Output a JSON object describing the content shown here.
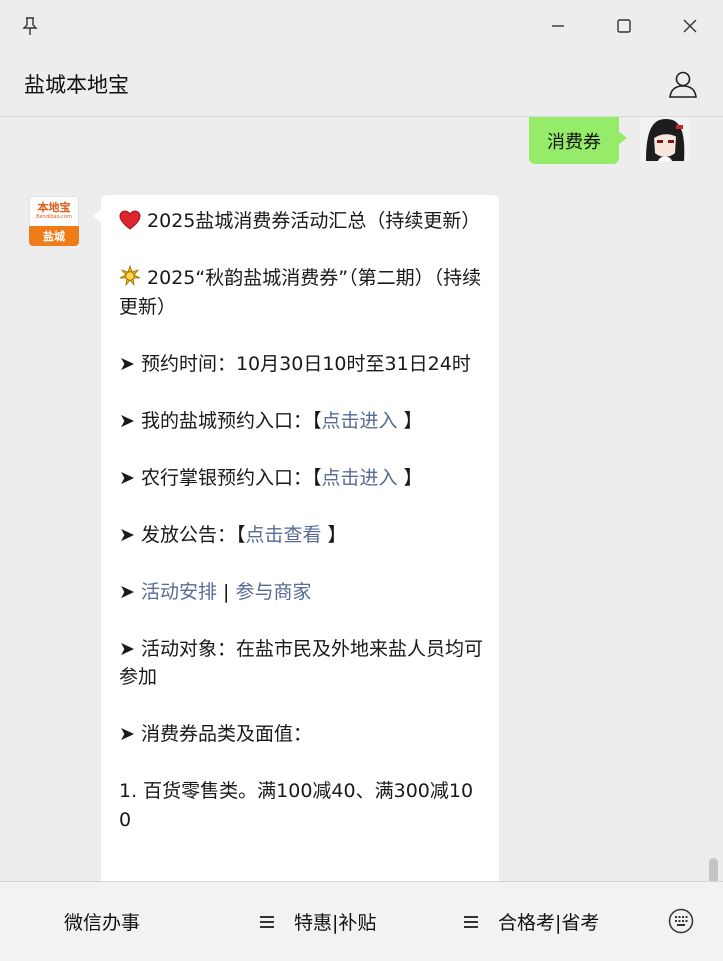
{
  "window": {
    "title": "盐城本地宝",
    "icons": [
      "pin-icon",
      "minimize-icon",
      "maximize-icon",
      "close-icon",
      "user-profile-icon"
    ]
  },
  "chat": {
    "sent_message": "消费券",
    "bot_avatar": {
      "brand": "本地宝",
      "sub": "Bendibao.com",
      "city": "盐城"
    },
    "reply": {
      "line1_text": "2025盐城消费券活动汇总（持续更新）",
      "line2_text": "2025“秋韵盐城消费券”（第二期）（持续更新）",
      "time_text": "➤ 预约时间：10月30日10时至31日24时",
      "mine_prefix": "➤ 我的盐城预约入口：【",
      "mine_link": "点击进入",
      "mine_suffix": " 】",
      "abc_prefix": "➤ 农行掌银预约入口：【",
      "abc_link": "点击进入",
      "abc_suffix": " 】",
      "notice_prefix": "➤ 发放公告：【",
      "notice_link": "点击查看",
      "notice_suffix": " 】",
      "arrange_prefix": "➤ ",
      "arrange_link": "活动安排",
      "arrange_sep": " | ",
      "merchants_link": "参与商家",
      "target_text": "➤ 活动对象：在盐市民及外地来盐人员均可参加",
      "category_text": "➤ 消费券品类及面值：",
      "item1_text": "1. 百货零售类。满100减40、满300减100"
    }
  },
  "footer": {
    "item1": "微信办事",
    "item2": "特惠|补贴",
    "item3": "合格考|省考"
  },
  "colors": {
    "background": "#ededed",
    "sent_bubble": "#95ec69",
    "link": "#576b95",
    "brand_orange": "#f07c19"
  }
}
